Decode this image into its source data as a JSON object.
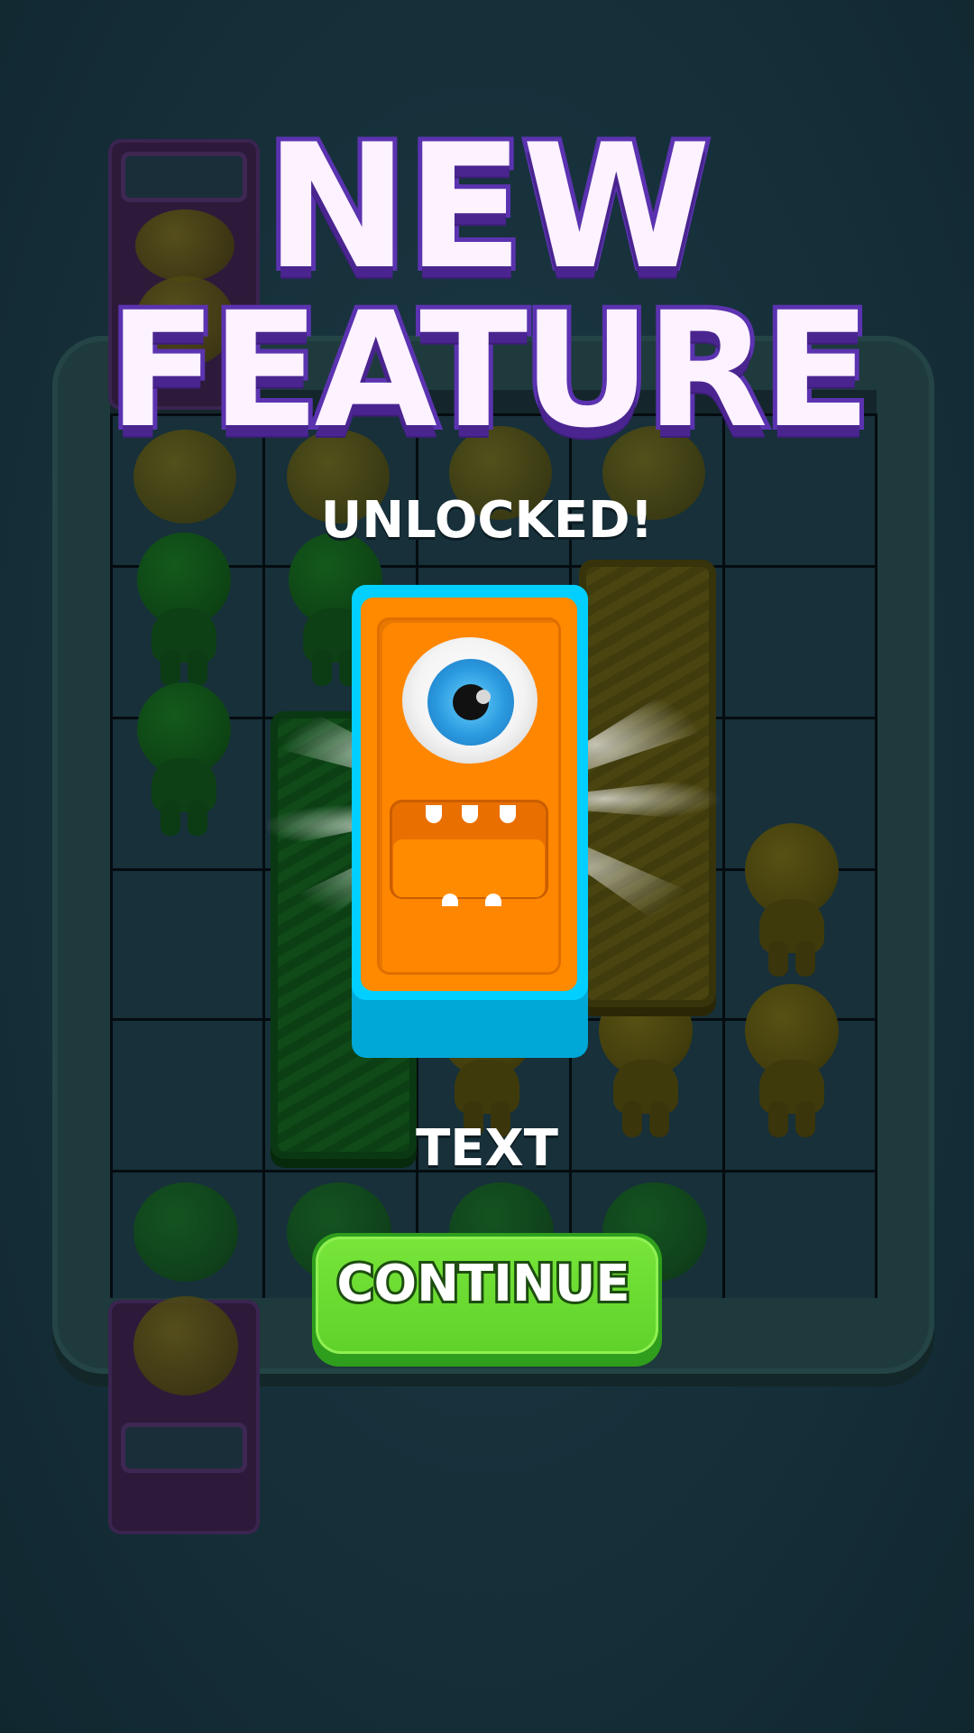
{
  "popup": {
    "title_line1": "NEW",
    "title_line2": "FEATURE",
    "subtitle": "UNLOCKED!",
    "description": "TEXT",
    "continue_label": "CONTINUE"
  },
  "feature_icon": "one-eyed-orange-monster-block",
  "colors": {
    "title_fill": "#fdf2ff",
    "title_outline": "#5b33b0",
    "button_green": "#5fd22a",
    "monster_orange": "#ff8a00",
    "monster_frame_cyan": "#00cfff",
    "background": "#183139"
  }
}
